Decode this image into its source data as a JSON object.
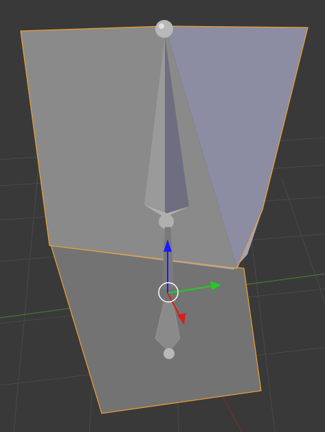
{
  "viewport": {
    "background": "#393939",
    "grid_color": "#4a4a4a",
    "axis_x_color": "#8a2a2a",
    "axis_y_color": "#3f8a2a",
    "selection_outline": "#f0a030"
  },
  "mesh": {
    "upper_face_color": "#8a8a8a",
    "upper_side_color": "#8c8ca3",
    "lower_face_color": "#737373"
  },
  "armature": {
    "bone_color": "#7a7a7a",
    "joint_color": "#b8b8b8"
  },
  "gizmo": {
    "z_arrow_color": "#1a1aff",
    "y_arrow_color": "#22cc22",
    "x_arrow_color": "#dd1a1a",
    "cursor_ring_color": "#ffffff",
    "icon": "3d-cursor-icon"
  }
}
